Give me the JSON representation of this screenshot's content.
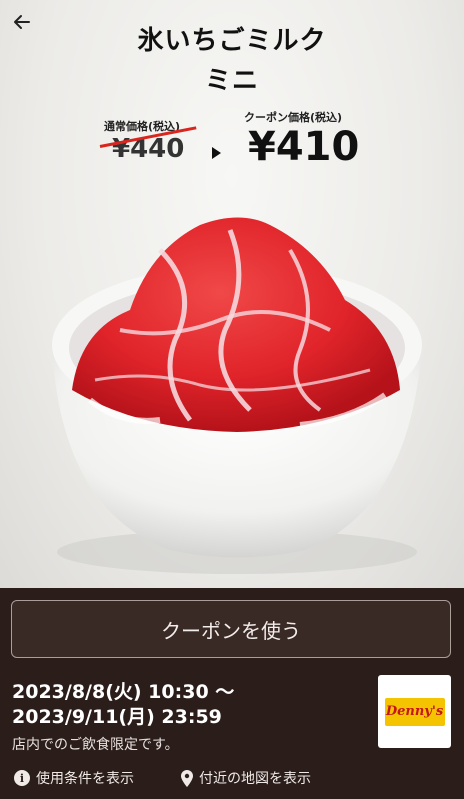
{
  "header": {
    "title_line1": "氷いちごミルク",
    "title_line2": "ミニ",
    "back_icon": "arrow-left-icon"
  },
  "pricing": {
    "regular_label": "通常価格(税込)",
    "regular_price": "¥440",
    "coupon_label": "クーポン価格(税込)",
    "coupon_price": "¥410"
  },
  "actions": {
    "use_coupon": "クーポンを使う"
  },
  "validity": {
    "line1": "2023/8/8(火) 10:30 〜",
    "line2": "2023/9/11(月) 23:59",
    "note": "店内でのご飲食限定です。"
  },
  "brand": {
    "logo_text": "Denny's"
  },
  "footer": {
    "terms_label": "使用条件を表示",
    "map_label": "付近の地図を表示"
  },
  "colors": {
    "bottom_bg": "#2b1d1a",
    "strike": "#d8261f",
    "logo_yellow": "#f5c400",
    "logo_red": "#c4161c"
  }
}
